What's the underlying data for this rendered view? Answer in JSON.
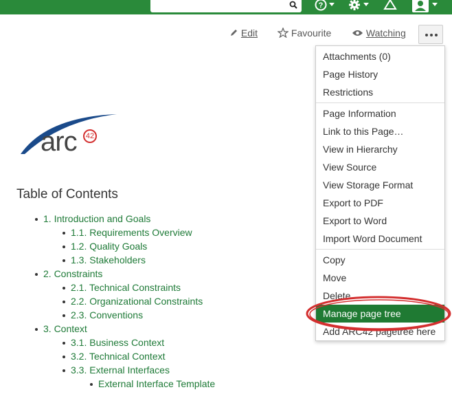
{
  "topbar": {
    "search_placeholder": "",
    "icons": [
      "search-icon",
      "help-icon",
      "settings-icon",
      "notifications-icon",
      "user-avatar-icon"
    ]
  },
  "page_actions": {
    "edit_label": "Edit",
    "favourite_label": "Favourite",
    "watching_label": "Watching"
  },
  "more_menu": {
    "group1": [
      "Attachments (0)",
      "Page History",
      "Restrictions"
    ],
    "group2": [
      "Page Information",
      "Link to this Page…",
      "View in Hierarchy",
      "View Source",
      "View Storage Format",
      "Export to PDF",
      "Export to Word",
      "Import Word Document"
    ],
    "group3": [
      "Copy",
      "Move",
      "Delete",
      "Manage page tree",
      "Add ARC42 pagetree here"
    ]
  },
  "logo": {
    "text": "arc",
    "badge": "42"
  },
  "toc": {
    "title": "Table of Contents",
    "items": [
      "1. Introduction and Goals",
      "1.1. Requirements Overview",
      "1.2. Quality Goals",
      "1.3. Stakeholders",
      "2. Constraints",
      "2.1. Technical Constraints",
      "2.2. Organizational Constraints",
      "2.3. Conventions",
      "3. Context",
      "3.1. Business Context",
      "3.2. Technical Context",
      "3.3. External Interfaces",
      "External Interface Template"
    ]
  },
  "colors": {
    "accent": "#2a8a3a",
    "link": "#1e7a37",
    "highlight": "#d32f2f"
  }
}
